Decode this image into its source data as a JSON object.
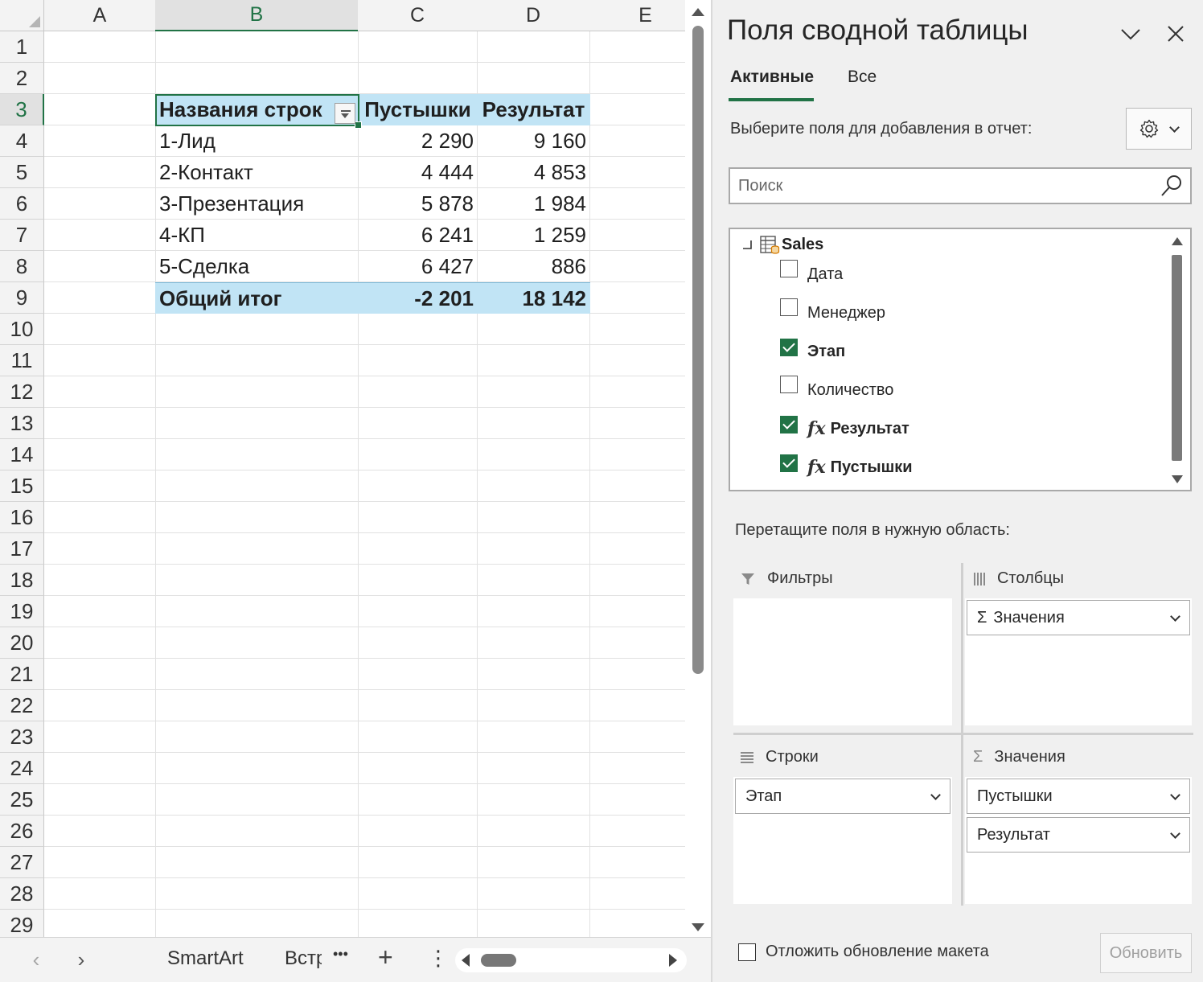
{
  "sheet": {
    "columns": [
      "A",
      "B",
      "C",
      "D",
      "E"
    ],
    "selected_column": "B",
    "rows": [
      "1",
      "2",
      "3",
      "4",
      "5",
      "6",
      "7",
      "8",
      "9",
      "10",
      "11",
      "12",
      "13",
      "14",
      "15",
      "16",
      "17",
      "18",
      "19",
      "20",
      "21",
      "22",
      "23",
      "24",
      "25",
      "26",
      "27",
      "28",
      "29"
    ],
    "selected_row": "3"
  },
  "pivot_table": {
    "header": {
      "row_labels": "Названия строк",
      "col1": "Пустышки",
      "col2": "Результат"
    },
    "rows": [
      {
        "label": "1-Лид",
        "col1": "2 290",
        "col2": "9 160"
      },
      {
        "label": "2-Контакт",
        "col1": "4 444",
        "col2": "4 853"
      },
      {
        "label": "3-Презентация",
        "col1": "5 878",
        "col2": "1 984"
      },
      {
        "label": "4-КП",
        "col1": "6 241",
        "col2": "1 259"
      },
      {
        "label": "5-Сделка",
        "col1": "6 427",
        "col2": "886"
      }
    ],
    "total": {
      "label": "Общий итог",
      "col1": "-2 201",
      "col2": "18 142"
    }
  },
  "sheet_tabs": {
    "tab1": "SmartArt",
    "tab2": "Встр",
    "more": "•••",
    "add": "+",
    "options": "⋮",
    "prev": "‹",
    "next": "›"
  },
  "pane": {
    "title": "Поля сводной таблицы",
    "tabs": {
      "active": "Активные",
      "all": "Все"
    },
    "choose_label": "Выберите поля для добавления в отчет:",
    "search_placeholder": "Поиск",
    "table_name": "Sales",
    "fields": [
      {
        "label": "Дата",
        "checked": false,
        "fx": false
      },
      {
        "label": "Менеджер",
        "checked": false,
        "fx": false
      },
      {
        "label": "Этап",
        "checked": true,
        "fx": false
      },
      {
        "label": "Количество",
        "checked": false,
        "fx": false
      },
      {
        "label": "Результат",
        "checked": true,
        "fx": true
      },
      {
        "label": "Пустышки",
        "checked": true,
        "fx": true
      }
    ],
    "fx_glyph": "fx",
    "drag_label": "Перетащите поля в нужную область:",
    "areas": {
      "filters": "Фильтры",
      "columns": "Столбцы",
      "rows": "Строки",
      "values": "Значения"
    },
    "pills": {
      "columns_values": "Значения",
      "rows_stage": "Этап",
      "values_1": "Пустышки",
      "values_2": "Результат"
    },
    "sigma": "Σ",
    "defer_label": "Отложить обновление макета",
    "update_button": "Обновить"
  },
  "colors": {
    "accent": "#217346",
    "pivot_header_bg": "#c1e4f5"
  }
}
